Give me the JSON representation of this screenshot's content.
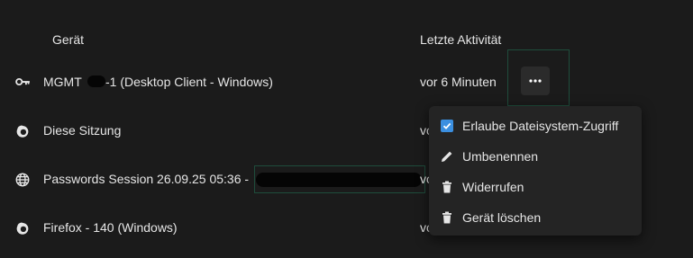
{
  "table": {
    "col_device": "Gerät",
    "col_activity": "Letzte Aktivität"
  },
  "rows": [
    {
      "icon": "key-icon",
      "name_prefix": "MGMT",
      "name_suffix": "-1 (Desktop Client - Windows)",
      "activity": "vor 6 Minuten"
    },
    {
      "icon": "firefox-icon",
      "name": "Diese Sitzung",
      "activity": "vo"
    },
    {
      "icon": "globe-icon",
      "name": "Passwords Session 26.09.25 05:36 -",
      "activity": "vo"
    },
    {
      "icon": "firefox-icon",
      "name": "Firefox - 140 (Windows)",
      "activity": "vo"
    }
  ],
  "menu": {
    "items": [
      {
        "icon": "checkbox-checked-icon",
        "label": "Erlaube Dateisystem-Zugriff",
        "checked": true
      },
      {
        "icon": "pencil-icon",
        "label": "Umbenennen"
      },
      {
        "icon": "trash-icon",
        "label": "Widerrufen"
      },
      {
        "icon": "trash-icon",
        "label": "Gerät löschen"
      }
    ]
  },
  "colors": {
    "background": "#1b1b1b",
    "accent": "#3b8fe0",
    "focus_border": "#1f4d3c"
  }
}
